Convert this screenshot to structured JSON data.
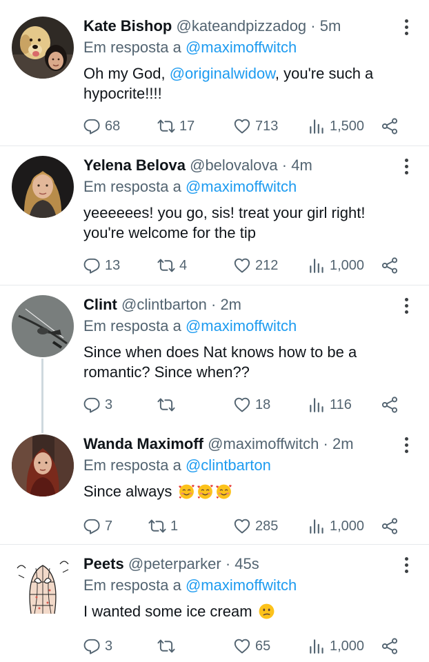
{
  "reply_prefix": "Em resposta a",
  "colors": {
    "mention": "#1d9bf0",
    "muted": "#536471",
    "text": "#0f1419"
  },
  "tweets": [
    {
      "name": "Kate Bishop",
      "handle": "@kateandpizzadog",
      "time": "5m",
      "reply_to": "@maximoffwitch",
      "text_before": "Oh my God, ",
      "text_mention": "@originalwidow",
      "text_after": ", you're such a hypocrite!!!!",
      "replies": "68",
      "retweets": "17",
      "likes": "713",
      "views": "1,500",
      "avatar": "golden-retriever-and-girl"
    },
    {
      "name": "Yelena Belova",
      "handle": "@belovalova",
      "time": "4m",
      "reply_to": "@maximoffwitch",
      "text": "yeeeeees! you go, sis! treat your girl right! you're welcome for the tip",
      "replies": "13",
      "retweets": "4",
      "likes": "212",
      "views": "1,000",
      "avatar": "blonde-woman"
    },
    {
      "name": "Clint",
      "handle": "@clintbarton",
      "time": "2m",
      "reply_to": "@maximoffwitch",
      "text": "Since when does Nat knows how to be a romantic? Since when??",
      "replies": "3",
      "retweets": "",
      "likes": "18",
      "views": "116",
      "avatar": "bow-and-arrow"
    },
    {
      "name": "Wanda Maximoff",
      "handle": "@maximoffwitch",
      "time": "2m",
      "reply_to": "@clintbarton",
      "text": "Since always",
      "emojis": [
        "smiling-face-with-hearts",
        "smiling-face-with-hearts",
        "smiling-face-with-hearts"
      ],
      "replies": "7",
      "retweets": "1",
      "likes": "285",
      "views": "1,000",
      "avatar": "red-haired-woman"
    },
    {
      "name": "Peets",
      "handle": "@peterparker",
      "time": "45s",
      "reply_to": "@maximoffwitch",
      "text": "I wanted some ice cream",
      "emojis": [
        "confused-face"
      ],
      "replies": "3",
      "retweets": "",
      "likes": "65",
      "views": "1,000",
      "avatar": "spider-man-sketch"
    }
  ]
}
